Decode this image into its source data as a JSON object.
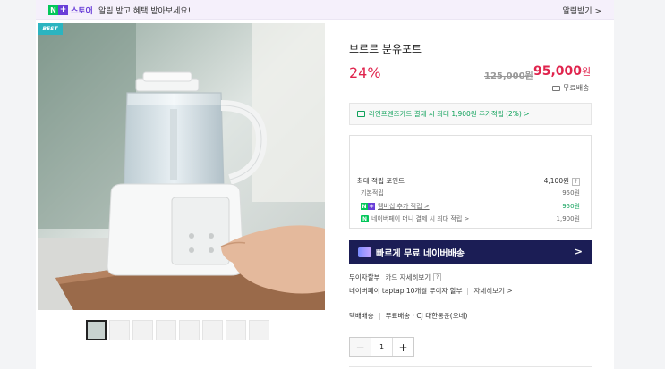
{
  "topbar": {
    "store_n": "N",
    "store_plus": "+",
    "store_label": "스토어",
    "message": "알림 받고 혜택 받아보세요!",
    "alarm_button": "알림받기 >"
  },
  "product": {
    "badge": "BEST",
    "title": "보르르 분유포트",
    "discount": "24%",
    "original_price": "125,000원",
    "price": "95,000",
    "price_unit": "원",
    "shipping_free": "무료배송",
    "card_benefit": "라인프렌즈카드 결제 시 최대 1,900원 추가적립 (2%) >"
  },
  "points": {
    "max_label": "최대 적립 포인트",
    "max_value": "4,100원",
    "help": "?",
    "rows": [
      {
        "label": "기본적립",
        "value": "950원"
      },
      {
        "label": "멤버십 추가 적립 >",
        "value": "950원"
      },
      {
        "label": "네이버페이 머니 결제 시 최대 적립 >",
        "value": "1,900원"
      }
    ]
  },
  "fast_shipping": {
    "label": "빠르게 무료 네이버배송",
    "chevron": ">"
  },
  "installment": {
    "label": "무이자할부",
    "detail": "카드 자세히보기",
    "help": "?",
    "taptap": "네이버페이 taptap 10개월 무이자 할부",
    "taptap_link": "자세히보기 >"
  },
  "delivery": {
    "label": "택배배송",
    "detail": "무료배송 · CJ 대한통운(오네)"
  },
  "quantity": {
    "minus": "−",
    "value": "1",
    "plus": "+"
  },
  "colors": {
    "accent_red": "#e0244d",
    "naver_green": "#03c75a",
    "plus_purple": "#6a3fd8",
    "fast_ship_navy": "#1b1d55"
  }
}
